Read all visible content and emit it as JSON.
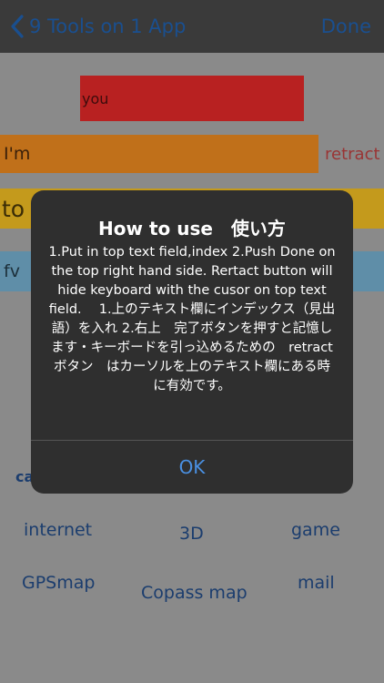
{
  "navbar": {
    "back_label": "9 Tools on 1 App",
    "done_label": "Done"
  },
  "fields": {
    "field1": "you",
    "field2": "I'm",
    "field3": "to",
    "field4": "fv"
  },
  "retract_label": "retract",
  "tools": {
    "camera_partial": "ca",
    "internet": "internet",
    "three_d": "3D",
    "game": "game",
    "gpsmap": "GPSmap",
    "compass_map": "Copass map",
    "mail": "mail"
  },
  "alert": {
    "title": "How to use　使い方",
    "message": "1.Put in top text field,index  2.Push Done on the top right hand side. Rertact button will hide keyboard with the cusor on top text field.　 1.上のテキスト欄にインデックス（見出語）を入れ 2.右上　完了ボタンを押すと記憶します・キーボードを引っ込めるための　retract ボタン　はカーソルを上のテキスト欄にある時に有効です。",
    "ok_label": "OK"
  },
  "colors": {
    "navbar_bg": "#3a3a3a",
    "link_blue": "#1a4f8f",
    "field1_bg": "#b82121",
    "field2_bg": "#c0701a",
    "field3_bg": "#c49a1c",
    "field4_bg": "#5f8ea8",
    "alert_bg": "#2f2f2f",
    "alert_ok": "#4a90e2"
  }
}
